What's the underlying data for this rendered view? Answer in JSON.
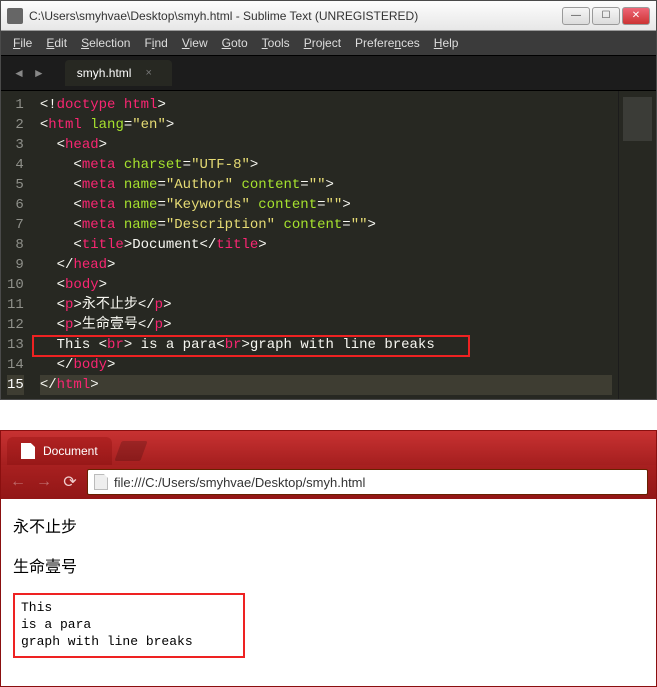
{
  "sublime": {
    "title": "C:\\Users\\smyhvae\\Desktop\\smyh.html - Sublime Text (UNREGISTERED)",
    "menu": [
      "File",
      "Edit",
      "Selection",
      "Find",
      "View",
      "Goto",
      "Tools",
      "Project",
      "Preferences",
      "Help"
    ],
    "tab_label": "smyh.html",
    "lines": [
      "1",
      "2",
      "3",
      "4",
      "5",
      "6",
      "7",
      "8",
      "9",
      "10",
      "11",
      "12",
      "13",
      "14",
      "15"
    ],
    "code": {
      "l1_doctype": "doctype html",
      "l2_html": "html",
      "l2_lang_attr": "lang",
      "l2_lang_val": "\"en\"",
      "l3_head": "head",
      "l4_meta": "meta",
      "l4_cs_attr": "charset",
      "l4_cs_val": "\"UTF-8\"",
      "l5_meta": "meta",
      "l5_name_attr": "name",
      "l5_name_val": "\"Author\"",
      "l5_cont_attr": "content",
      "l5_cont_val": "\"\"",
      "l6_meta": "meta",
      "l6_name_attr": "name",
      "l6_name_val": "\"Keywords\"",
      "l6_cont_attr": "content",
      "l6_cont_val": "\"\"",
      "l7_meta": "meta",
      "l7_name_attr": "name",
      "l7_name_val": "\"Description\"",
      "l7_cont_attr": "content",
      "l7_cont_val": "\"\"",
      "l8_title": "title",
      "l8_title_txt": "Document",
      "l9_head": "head",
      "l10_body": "body",
      "l11_p": "p",
      "l11_txt": "永不止步",
      "l12_p": "p",
      "l12_txt": "生命壹号",
      "l13_t1": "This ",
      "l13_br": "br",
      "l13_t2": " is a para",
      "l13_t3": "graph with line breaks",
      "l14_body": "body",
      "l15_html": "html"
    }
  },
  "chrome": {
    "tab_label": "Document",
    "url": "file:///C:/Users/smyhvae/Desktop/smyh.html",
    "page": {
      "p1": "永不止步",
      "p2": "生命壹号",
      "b1": "This",
      "b2": "is a para",
      "b3": "graph with line breaks"
    }
  }
}
